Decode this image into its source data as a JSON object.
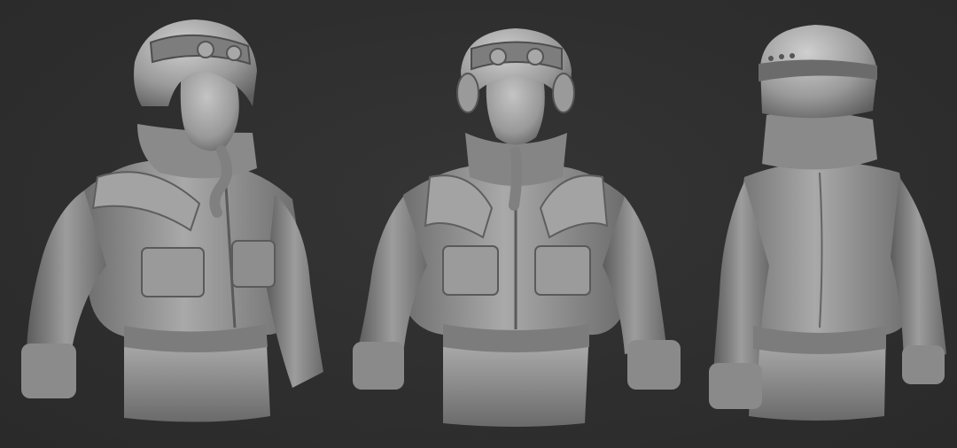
{
  "scene": {
    "views": [
      {
        "name": "three-quarter-view"
      },
      {
        "name": "front-view"
      },
      {
        "name": "back-view"
      }
    ]
  },
  "colors": {
    "background": "#2f2f2f",
    "clay_light": "#b4b4b4",
    "clay_mid": "#8f8f8f",
    "clay_dark": "#5e5e5e",
    "clay_shadow": "#3e3e3e"
  }
}
